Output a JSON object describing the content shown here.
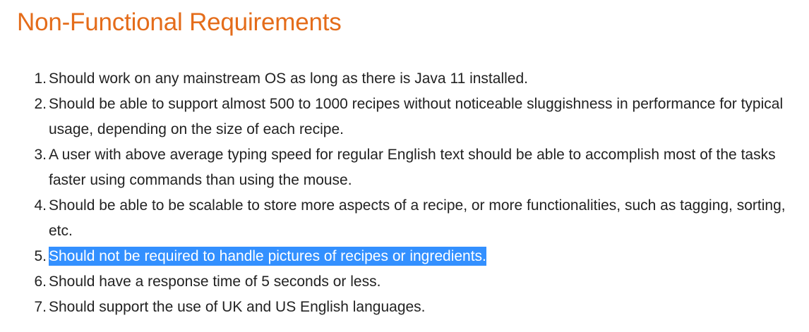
{
  "heading": {
    "title": "Non-Functional Requirements"
  },
  "requirements": [
    {
      "number": "1.",
      "text": "Should work on any mainstream OS as long as there is Java 11 installed."
    },
    {
      "number": "2.",
      "text": "Should be able to support almost 500 to 1000 recipes without noticeable sluggishness in performance for typical usage, depending on the size of each recipe."
    },
    {
      "number": "3.",
      "text": "A user with above average typing speed for regular English text should be able to accomplish most of the tasks faster using commands than using the mouse."
    },
    {
      "number": "4.",
      "text": "Should be able to be scalable to store more aspects of a recipe, or more functionalities, such as tagging, sorting, etc."
    },
    {
      "number": "5.",
      "text": "Should not be required to handle pictures of recipes or ingredients."
    },
    {
      "number": "6.",
      "text": "Should have a response time of 5 seconds or less."
    },
    {
      "number": "7.",
      "text": "Should support the use of UK and US English languages."
    }
  ],
  "colors": {
    "heading": "#e46c1a",
    "body_text": "#222222",
    "selection_background": "#3390ff",
    "selection_text": "#ffffff"
  }
}
